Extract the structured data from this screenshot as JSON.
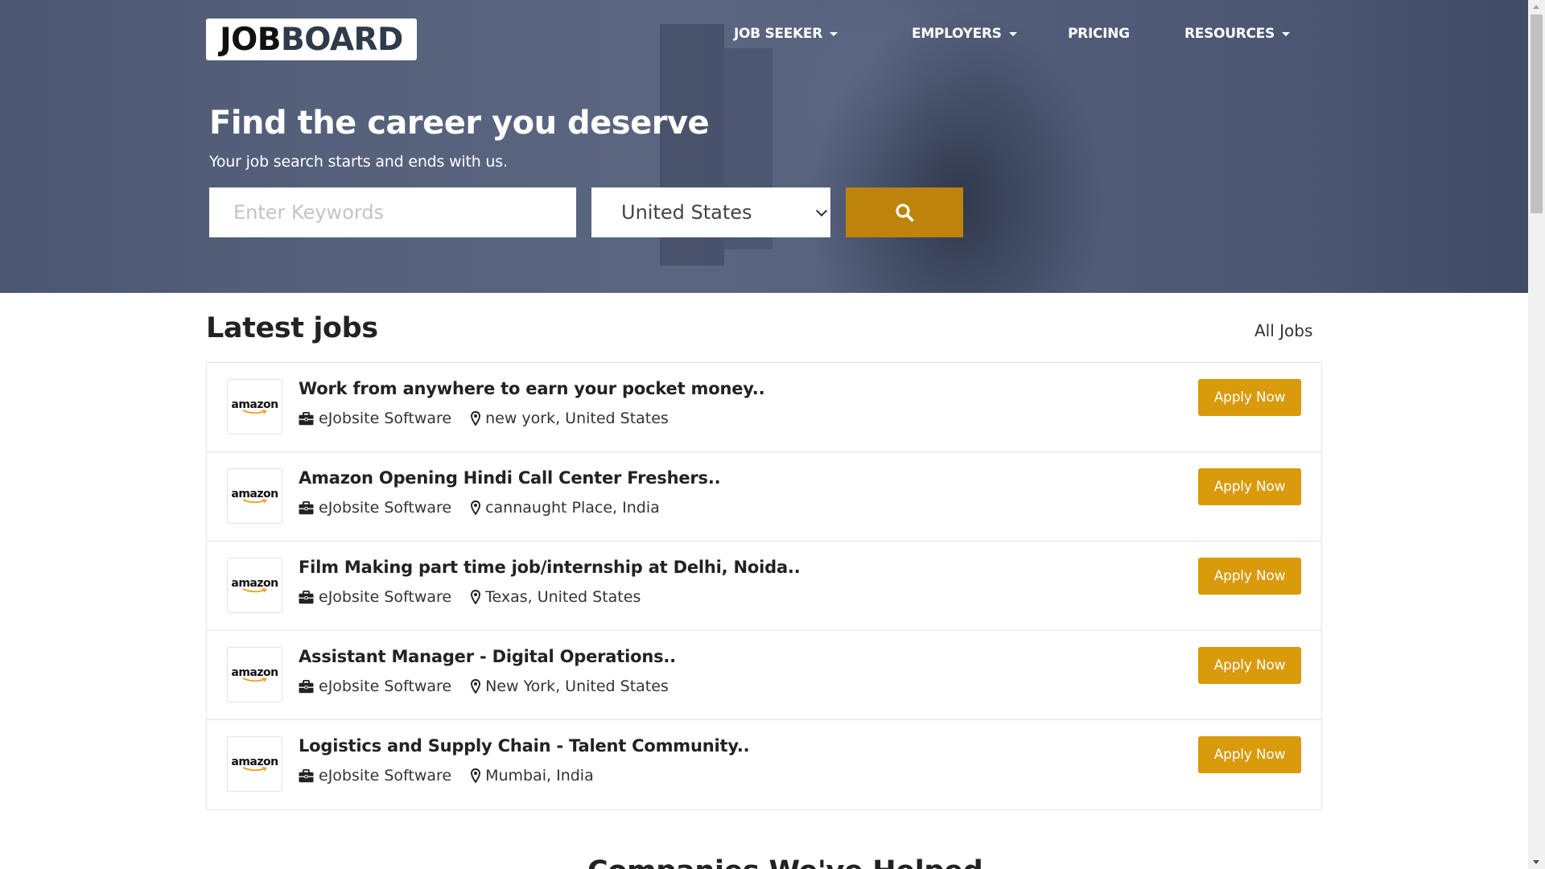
{
  "logo": {
    "part1": "JOB",
    "part2": "BOARD"
  },
  "nav": {
    "items": [
      {
        "label": "JOB SEEKER",
        "has_dropdown": true
      },
      {
        "label": "EMPLOYERS",
        "has_dropdown": true
      },
      {
        "label": "PRICING",
        "has_dropdown": false
      },
      {
        "label": "RESOURCES",
        "has_dropdown": true
      }
    ]
  },
  "hero": {
    "title": "Find the career you deserve",
    "subtitle": "Your job search starts and ends with us.",
    "keyword_placeholder": "Enter Keywords",
    "keyword_value": "",
    "country_selected": "United States",
    "search_icon": "search-icon"
  },
  "latest_jobs": {
    "heading": "Latest jobs",
    "all_jobs_label": "All Jobs",
    "apply_label": "Apply Now",
    "logo_text": "amazon",
    "jobs": [
      {
        "title": "Work from anywhere to earn your pocket money..",
        "company": "eJobsite Software",
        "location": "new york, United States"
      },
      {
        "title": "Amazon Opening Hindi Call Center Freshers..",
        "company": "eJobsite Software",
        "location": "cannaught Place, India"
      },
      {
        "title": "Film Making part time job/internship at Delhi, Noida..",
        "company": "eJobsite Software",
        "location": "Texas, United States"
      },
      {
        "title": "Assistant Manager - Digital Operations..",
        "company": "eJobsite Software",
        "location": "New York, United States"
      },
      {
        "title": "Logistics and Supply Chain - Talent Community..",
        "company": "eJobsite Software",
        "location": "Mumbai, India"
      }
    ]
  },
  "next_section_heading": "Companies We've Helped",
  "colors": {
    "search_button": "#be830b",
    "apply_button": "#d99a0b",
    "hero_overlay": "#505c77"
  }
}
